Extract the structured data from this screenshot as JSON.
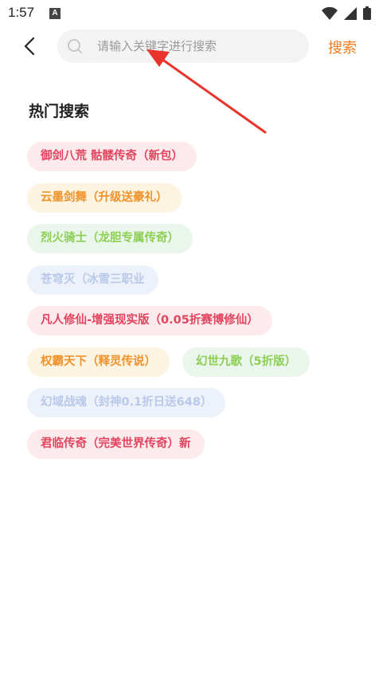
{
  "status_bar": {
    "time": "1:57",
    "notification_glyph": "A"
  },
  "header": {
    "search_placeholder": "请输入关键字进行搜索",
    "search_button_label": "搜索"
  },
  "hot_search": {
    "title": "热门搜索",
    "tags": [
      {
        "label": "御剑八荒 骷髅传奇（新包）",
        "color": "red"
      },
      {
        "label": "云墨剑舞（升级送豪礼）",
        "color": "orange"
      },
      {
        "label": "烈火骑士（龙胆专属传奇）",
        "color": "green"
      },
      {
        "label": "苍穹灭（冰雪三职业",
        "color": "blue"
      },
      {
        "label": "凡人修仙-增强现实版（0.05折赛博修仙）",
        "color": "red"
      },
      {
        "label": "权霸天下（释灵传说）",
        "color": "orange"
      },
      {
        "label": "幻世九歌（5折版）",
        "color": "green"
      },
      {
        "label": "幻域战魂（封神0.1折日送648）",
        "color": "blue"
      },
      {
        "label": "君临传奇（完美世界传奇）新",
        "color": "red"
      }
    ]
  },
  "colors": {
    "accent": "#f07a1a",
    "annotation_arrow": "#e8342b"
  }
}
